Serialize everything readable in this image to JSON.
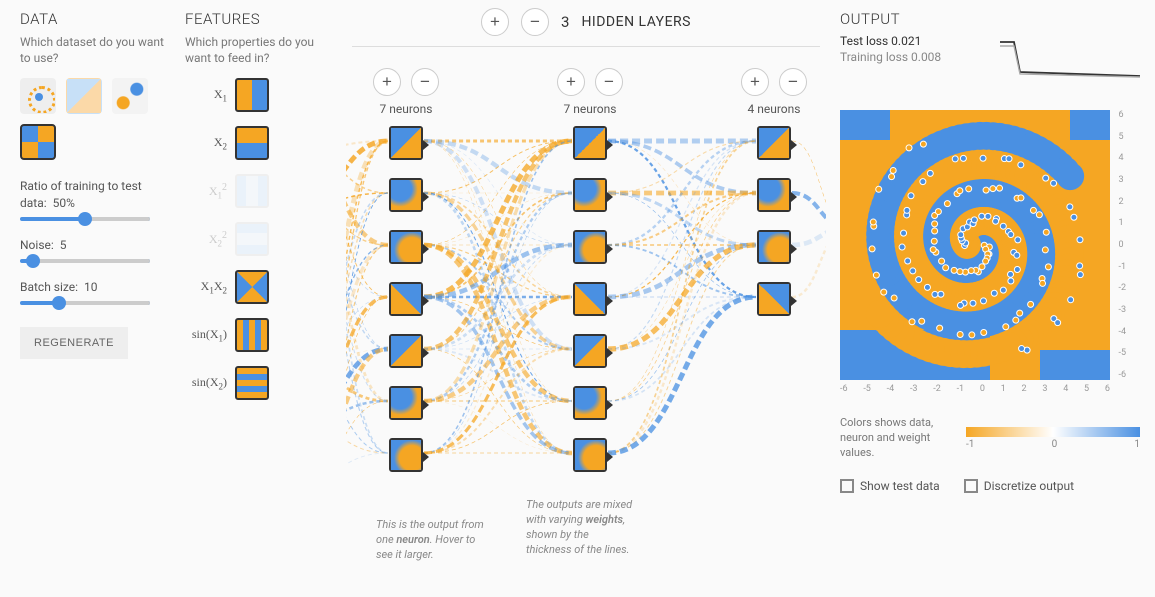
{
  "data": {
    "header": "DATA",
    "sub": "Which dataset do you want to use?",
    "datasets": [
      "circle",
      "xor",
      "gauss",
      "spiral"
    ],
    "selected_dataset": "spiral",
    "ratio_label": "Ratio of training to test data:",
    "ratio_value": "50%",
    "ratio_pct": 50,
    "noise_label": "Noise:",
    "noise_value": "5",
    "noise_pct": 10,
    "batch_label": "Batch size:",
    "batch_value": "10",
    "batch_pct": 30,
    "regenerate": "REGENERATE"
  },
  "features": {
    "header": "FEATURES",
    "sub": "Which properties do you want to feed in?",
    "items": [
      {
        "label_html": "X<sub>1</sub>",
        "enabled": true,
        "thumb": "th-x1"
      },
      {
        "label_html": "X<sub>2</sub>",
        "enabled": true,
        "thumb": "th-x2"
      },
      {
        "label_html": "X<sub>1</sub><sup>2</sup>",
        "enabled": false,
        "thumb": "th-x1s"
      },
      {
        "label_html": "X<sub>2</sub><sup>2</sup>",
        "enabled": false,
        "thumb": "th-x2s"
      },
      {
        "label_html": "X<sub>1</sub>X<sub>2</sub>",
        "enabled": true,
        "thumb": "th-x1x2"
      },
      {
        "label_html": "sin(X<sub>1</sub>)",
        "enabled": true,
        "thumb": "th-sin1"
      },
      {
        "label_html": "sin(X<sub>2</sub>)",
        "enabled": true,
        "thumb": "th-sin2"
      }
    ]
  },
  "hidden": {
    "count": "3",
    "title": "HIDDEN LAYERS",
    "layers": [
      {
        "neurons": 7,
        "label": "7 neurons"
      },
      {
        "neurons": 7,
        "label": "7 neurons"
      },
      {
        "neurons": 4,
        "label": "4 neurons"
      }
    ],
    "callout1": "This is the output from one <b>neuron</b>. Hover to see it larger.",
    "callout2": "The outputs are mixed with varying <b>weights</b>, shown by the thickness of the lines."
  },
  "output": {
    "header": "OUTPUT",
    "test_loss_label": "Test loss",
    "test_loss_value": "0.021",
    "train_loss_label": "Training loss",
    "train_loss_value": "0.008",
    "axis_ticks": [
      "-6",
      "-5",
      "-4",
      "-3",
      "-2",
      "-1",
      "0",
      "1",
      "2",
      "3",
      "4",
      "5",
      "6"
    ],
    "axis_ticks_r": [
      "6",
      "5",
      "4",
      "3",
      "2",
      "1",
      "0",
      "-1",
      "-2",
      "-3",
      "-4",
      "-5",
      "-6"
    ],
    "legend_text": "Colors shows data, neuron and weight values.",
    "legend_min": "-1",
    "legend_mid": "0",
    "legend_max": "1",
    "show_test": "Show test data",
    "discretize": "Discretize output"
  },
  "colors": {
    "orange": "#f5a623",
    "blue": "#4a90e2"
  }
}
